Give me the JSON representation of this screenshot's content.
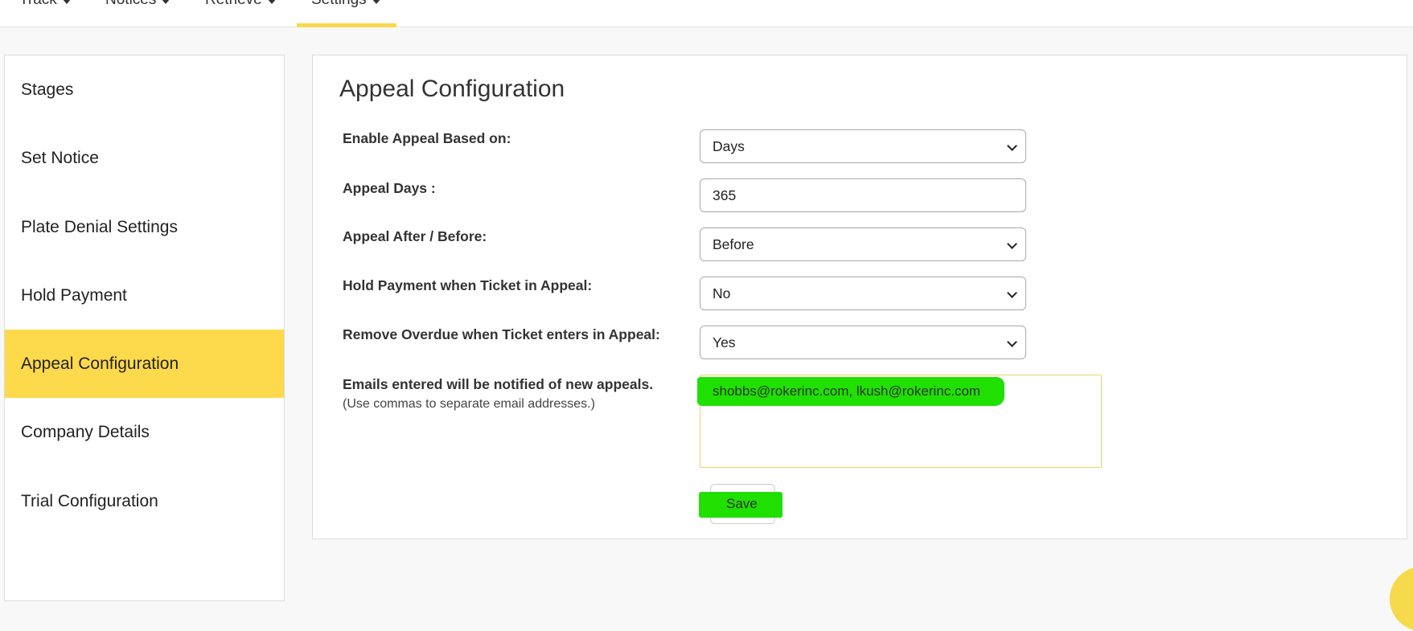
{
  "nav": {
    "items": [
      {
        "label": "Track"
      },
      {
        "label": "Notices"
      },
      {
        "label": "Retrieve"
      },
      {
        "label": "Settings"
      }
    ]
  },
  "sidebar": {
    "items": [
      {
        "label": "Stages"
      },
      {
        "label": "Set Notice"
      },
      {
        "label": "Plate Denial Settings"
      },
      {
        "label": "Hold Payment"
      },
      {
        "label": "Appeal Configuration"
      },
      {
        "label": "Company Details"
      },
      {
        "label": "Trial Configuration"
      }
    ],
    "active": "Appeal Configuration"
  },
  "main": {
    "title": "Appeal Configuration",
    "rows": [
      {
        "label": "Enable Appeal Based on:",
        "value": "Days"
      },
      {
        "label": "Appeal Days :",
        "value": "365"
      },
      {
        "label": "Appeal After / Before:",
        "value": "Before"
      },
      {
        "label": "Hold Payment when Ticket in Appeal:",
        "value": "No"
      },
      {
        "label": "Remove Overdue when Ticket enters in Appeal:",
        "value": "Yes"
      }
    ],
    "emails": {
      "label": "Emails entered will be notified of new appeals.",
      "hint": "(Use commas to separate email addresses.)",
      "value": "shobbs@rokerinc.com, lkush@rokerinc.com"
    },
    "save_label": "Save"
  },
  "colors": {
    "accent": "#fdd94c",
    "highlight": "#1fe000"
  }
}
